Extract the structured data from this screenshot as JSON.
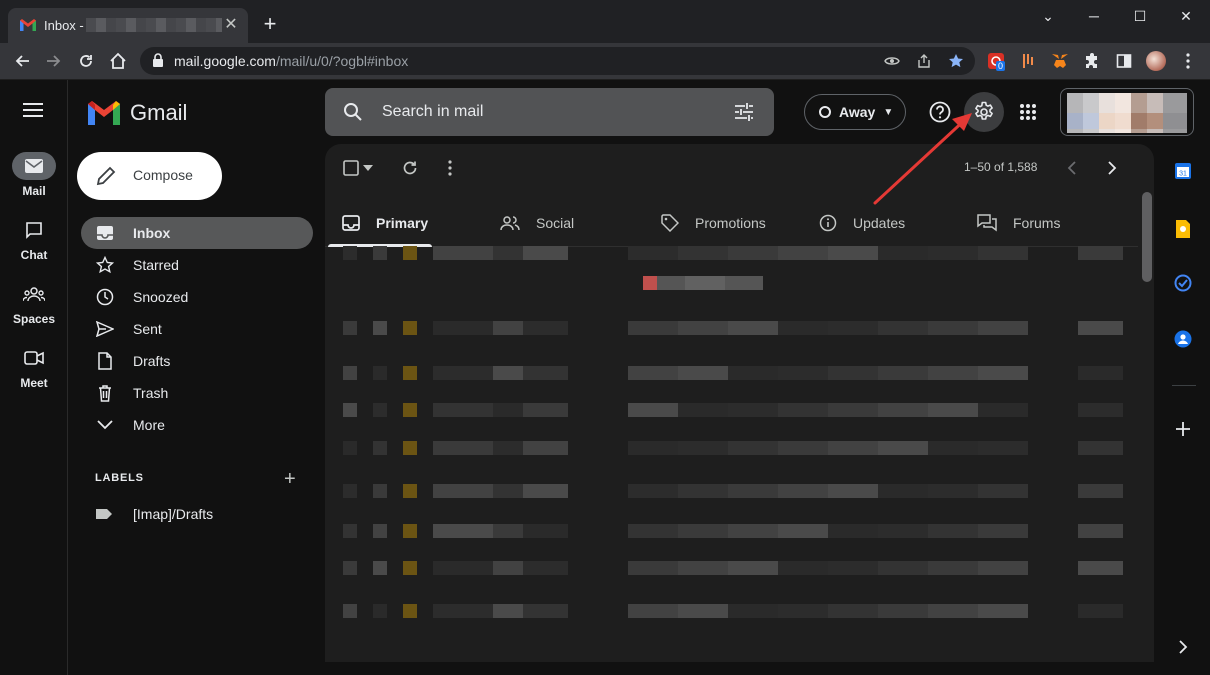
{
  "browser": {
    "tab_title": "Inbox -",
    "new_tab_label": "+",
    "url_host": "mail.google.com",
    "url_path": "/mail/u/0/?ogbl#inbox",
    "extension_badge": "0"
  },
  "app": {
    "name": "Gmail"
  },
  "rail": {
    "items": [
      {
        "label": "Mail",
        "icon": "mail-icon"
      },
      {
        "label": "Chat",
        "icon": "chat-icon"
      },
      {
        "label": "Spaces",
        "icon": "spaces-icon"
      },
      {
        "label": "Meet",
        "icon": "meet-icon"
      }
    ]
  },
  "compose": {
    "label": "Compose"
  },
  "nav": {
    "items": [
      {
        "label": "Inbox",
        "icon": "inbox-icon"
      },
      {
        "label": "Starred",
        "icon": "star-icon"
      },
      {
        "label": "Snoozed",
        "icon": "clock-icon"
      },
      {
        "label": "Sent",
        "icon": "send-icon"
      },
      {
        "label": "Drafts",
        "icon": "draft-icon"
      },
      {
        "label": "Trash",
        "icon": "trash-icon"
      },
      {
        "label": "More",
        "icon": "chevron-down-icon"
      }
    ]
  },
  "labels": {
    "heading": "LABELS",
    "add": "+",
    "items": [
      {
        "label": "[Imap]/Drafts"
      }
    ]
  },
  "search": {
    "placeholder": "Search in mail"
  },
  "status": {
    "label": "Away"
  },
  "list": {
    "pager": "1–50 of 1,588"
  },
  "tabs": [
    {
      "label": "Primary",
      "icon": "inbox-tab-icon"
    },
    {
      "label": "Social",
      "icon": "people-icon"
    },
    {
      "label": "Promotions",
      "icon": "tag-icon"
    },
    {
      "label": "Updates",
      "icon": "info-icon"
    },
    {
      "label": "Forums",
      "icon": "forum-icon"
    }
  ],
  "colors": {
    "accent_arrow": "#e53935",
    "important_marker": "#6b5413"
  }
}
